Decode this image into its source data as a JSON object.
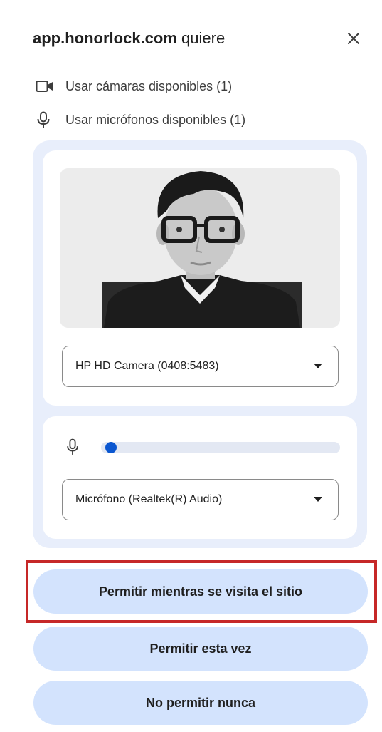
{
  "dialog": {
    "site": "app.honorlock.com",
    "title_suffix": " quiere"
  },
  "permissions": [
    {
      "icon": "video-camera-icon",
      "label": "Usar cámaras disponibles (1)"
    },
    {
      "icon": "microphone-icon",
      "label": "Usar micrófonos disponibles (1)"
    }
  ],
  "camera": {
    "selected_device": "HP HD Camera (0408:5483)"
  },
  "microphone": {
    "level": 0.02,
    "selected_device": "Micrófono (Realtek(R) Audio)"
  },
  "buttons": {
    "allow_while_visiting": "Permitir mientras se visita el sitio",
    "allow_this_time": "Permitir esta vez",
    "never_allow": "No permitir nunca"
  },
  "colors": {
    "accent": "#0b57d0",
    "button_bg": "#d3e3fd",
    "panel_bg": "#e8eefb",
    "highlight": "#c62828"
  }
}
